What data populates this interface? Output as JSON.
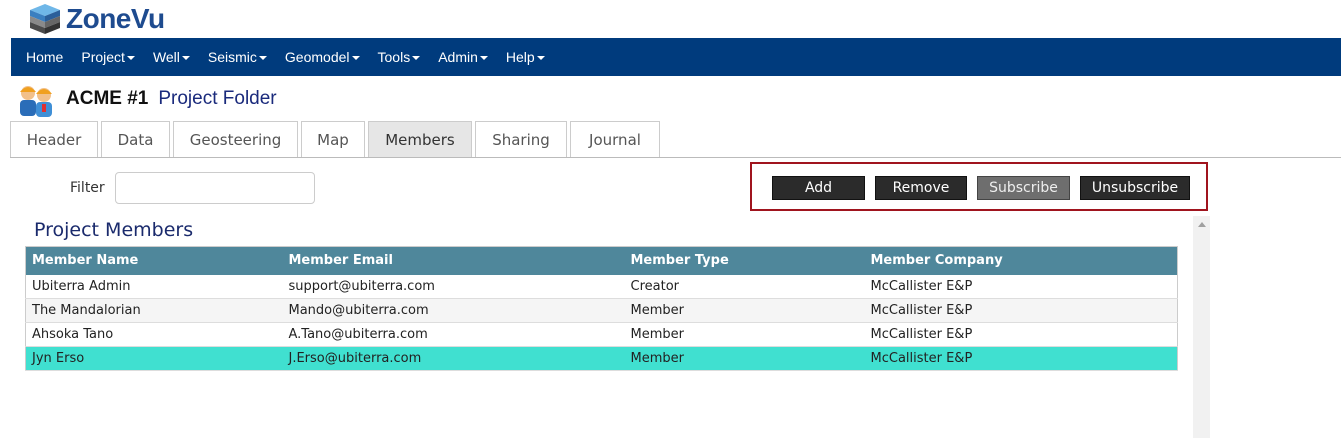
{
  "app": {
    "logo_text_zone": "Zone",
    "logo_text_vu": "Vu"
  },
  "nav": {
    "items": [
      {
        "label": "Home",
        "has_caret": false
      },
      {
        "label": "Project",
        "has_caret": true
      },
      {
        "label": "Well",
        "has_caret": true
      },
      {
        "label": "Seismic",
        "has_caret": true
      },
      {
        "label": "Geomodel",
        "has_caret": true
      },
      {
        "label": "Tools",
        "has_caret": true
      },
      {
        "label": "Admin",
        "has_caret": true
      },
      {
        "label": "Help",
        "has_caret": true
      }
    ]
  },
  "project": {
    "name": "ACME #1",
    "folder_label": "Project Folder"
  },
  "tabs": [
    {
      "label": "Header",
      "active": false
    },
    {
      "label": "Data",
      "active": false
    },
    {
      "label": "Geosteering",
      "active": false
    },
    {
      "label": "Map",
      "active": false
    },
    {
      "label": "Members",
      "active": true
    },
    {
      "label": "Sharing",
      "active": false
    },
    {
      "label": "Journal",
      "active": false
    }
  ],
  "filter": {
    "label": "Filter",
    "value": ""
  },
  "actions": {
    "add": "Add",
    "remove": "Remove",
    "subscribe": "Subscribe",
    "unsubscribe": "Unsubscribe"
  },
  "members": {
    "title": "Project Members",
    "columns": [
      "Member Name",
      "Member Email",
      "Member Type",
      "Member Company"
    ],
    "rows": [
      {
        "name": "Ubiterra Admin",
        "email": "support@ubiterra.com",
        "type": "Creator",
        "company": "McCallister E&P",
        "selected": false
      },
      {
        "name": "The Mandalorian",
        "email": "Mando@ubiterra.com",
        "type": "Member",
        "company": "McCallister E&P",
        "selected": false
      },
      {
        "name": "Ahsoka Tano",
        "email": "A.Tano@ubiterra.com",
        "type": "Member",
        "company": "McCallister E&P",
        "selected": false
      },
      {
        "name": "Jyn Erso",
        "email": "J.Erso@ubiterra.com",
        "type": "Member",
        "company": "McCallister E&P",
        "selected": true
      }
    ]
  },
  "colors": {
    "nav_bg": "#003b7d",
    "table_header_bg": "#4f879b",
    "selected_row_bg": "#40e0d0",
    "highlight_box": "#a0141e"
  }
}
